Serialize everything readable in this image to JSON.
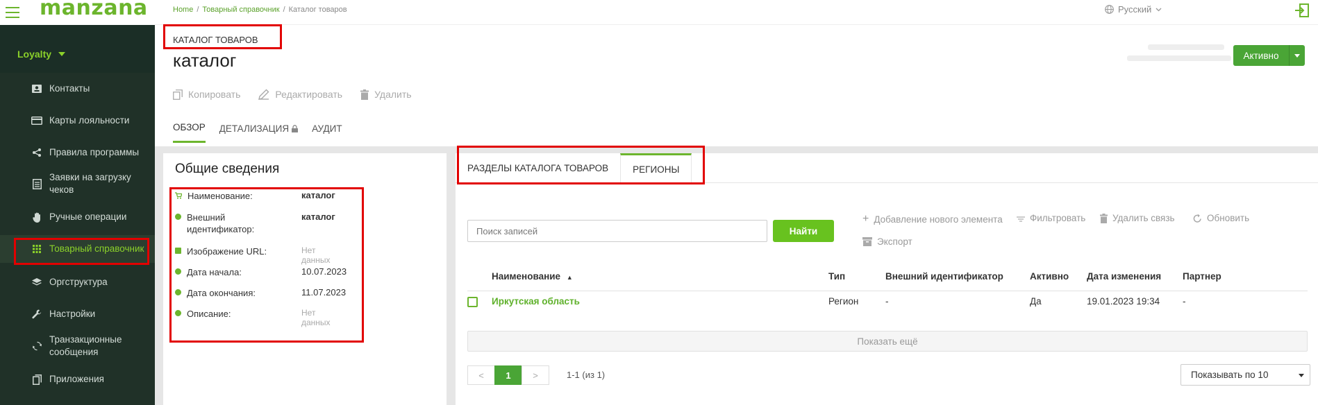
{
  "app": {
    "logo": "manzana",
    "section": "Loyalty"
  },
  "sidebar": {
    "items": [
      {
        "label": "Контакты",
        "icon": "contact-card-icon"
      },
      {
        "label": "Карты лояльности",
        "icon": "credit-card-icon"
      },
      {
        "label": "Правила программы",
        "icon": "share-nodes-icon"
      },
      {
        "label": "Заявки на загрузку чеков",
        "icon": "document-list-icon"
      },
      {
        "label": "Ручные операции",
        "icon": "hand-icon"
      },
      {
        "label": "Товарный справочник",
        "icon": "grid-icon"
      },
      {
        "label": "Оргструктура",
        "icon": "layers-icon"
      },
      {
        "label": "Настройки",
        "icon": "wrench-icon"
      },
      {
        "label": "Транзакционные сообщения",
        "icon": "sync-icon"
      },
      {
        "label": "Приложения",
        "icon": "copy-pages-icon"
      }
    ],
    "active_index": 5
  },
  "breadcrumb": {
    "home": "Home",
    "parent": "Товарный справочник",
    "current": "Каталог товаров"
  },
  "topbar": {
    "language": "Русский"
  },
  "header": {
    "entity_type": "КАТАЛОГ ТОВАРОВ",
    "entity_name": "каталог",
    "status": "Активно",
    "actions": {
      "copy": "Копировать",
      "edit": "Редактировать",
      "delete": "Удалить"
    },
    "tabs": [
      {
        "label": "ОБЗОР",
        "active": true
      },
      {
        "label": "ДЕТАЛИЗАЦИЯ",
        "active": false,
        "locked": true
      },
      {
        "label": "АУДИТ",
        "active": false
      }
    ]
  },
  "general": {
    "title": "Общие сведения",
    "fields": [
      {
        "label": "Наименование:",
        "value": "каталог"
      },
      {
        "label": "Внешний идентификатор:",
        "value": "каталог"
      },
      {
        "label": "Изображение URL:",
        "value": "Нет данных"
      },
      {
        "label": "Дата начала:",
        "value": "10.07.2023"
      },
      {
        "label": "Дата окончания:",
        "value": "11.07.2023"
      },
      {
        "label": "Описание:",
        "value": "Нет данных"
      }
    ]
  },
  "related": {
    "tabs": [
      {
        "label": "РАЗДЕЛЫ КАТАЛОГА ТОВАРОВ",
        "active": false
      },
      {
        "label": "РЕГИОНЫ",
        "active": true
      }
    ],
    "search_placeholder": "Поиск записей",
    "find_button": "Найти",
    "toolbar": {
      "add": "Добавление нового элемента",
      "filter": "Фильтровать",
      "unlink": "Удалить связь",
      "refresh": "Обновить",
      "export": "Экспорт"
    },
    "columns": [
      "Наименование",
      "Тип",
      "Внешний идентификатор",
      "Активно",
      "Дата изменения",
      "Партнер"
    ],
    "rows": [
      {
        "name": "Иркутская область",
        "type": "Регион",
        "external_id": "-",
        "active": "Да",
        "modified": "19.01.2023 19:34",
        "partner": "-"
      }
    ],
    "show_more": "Показать ещё",
    "pager": {
      "prev": "<",
      "page": "1",
      "next": ">",
      "info": "1-1 (из 1)"
    },
    "per_page": "Показывать по 10"
  },
  "colors": {
    "brand": "#6cb52d",
    "sidebar_bg": "#203128",
    "status_green": "#4aa536",
    "annotation_red": "#e20000"
  }
}
